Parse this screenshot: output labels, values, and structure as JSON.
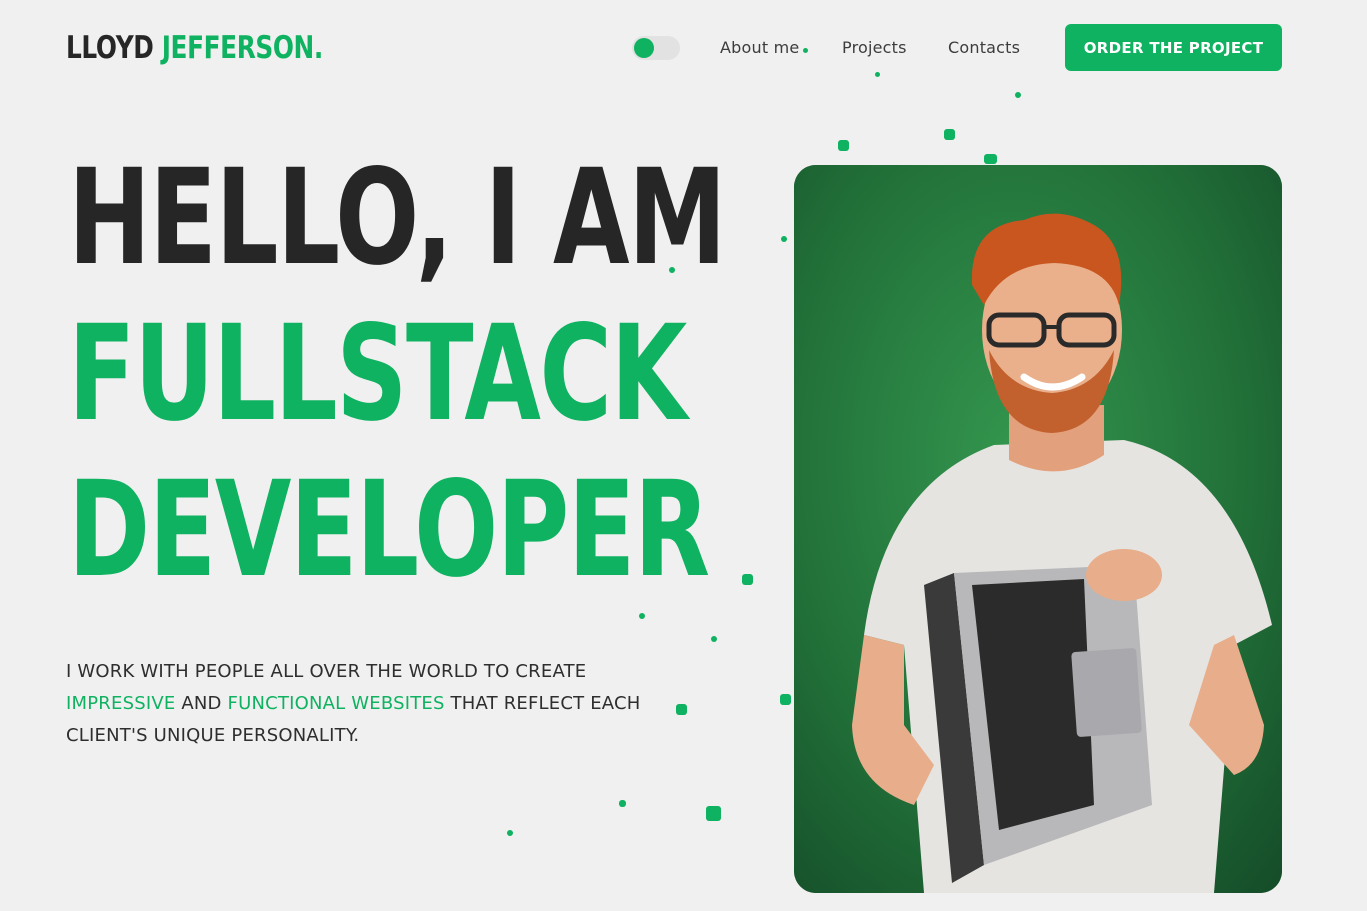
{
  "header": {
    "logo_first": "LLOYD",
    "logo_last": "JEFFERSON.",
    "nav": [
      {
        "label": "About me"
      },
      {
        "label": "Projects"
      },
      {
        "label": "Contacts"
      }
    ],
    "cta_label": "ORDER THE PROJECT"
  },
  "hero": {
    "line1": "HELLO, I AM",
    "line2": "FULLSTACK",
    "line3": "DEVELOPER",
    "tagline": {
      "part1": "I WORK WITH PEOPLE ALL OVER THE WORLD TO CREATE",
      "highlight1": "IMPRESSIVE",
      "part2": "AND",
      "highlight2": "FUNCTIONAL WEBSITES",
      "part3": "THAT REFLECT EACH CLIENT'S UNIQUE PERSONALITY."
    }
  },
  "colors": {
    "accent": "#0fb260",
    "background": "#f0f0f0",
    "text": "#262626",
    "photo_bg": "#1f6a35"
  },
  "icons": {
    "theme_toggle": "toggle-switch-icon"
  }
}
